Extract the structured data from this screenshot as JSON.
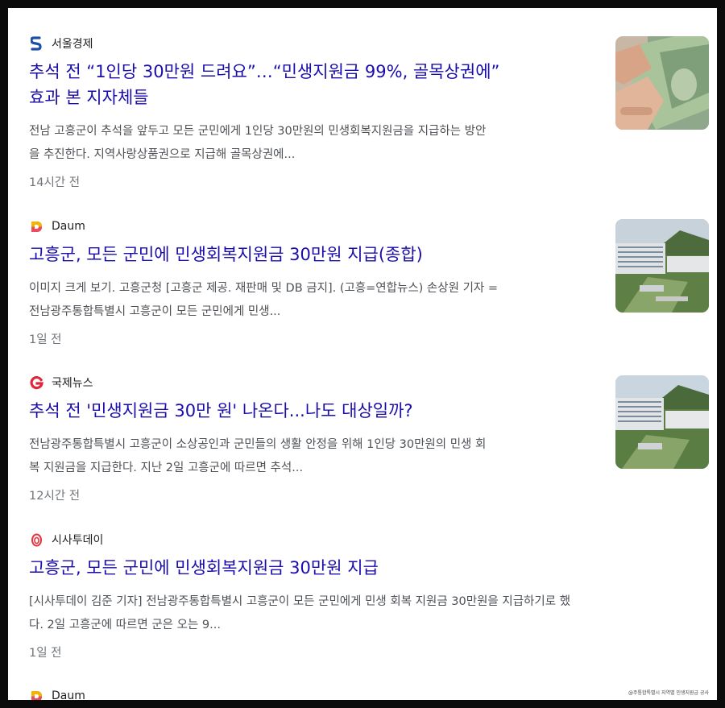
{
  "articles": [
    {
      "source": "서울경제",
      "source_icon": "seoul-economy-logo",
      "title_line1": "추석 전 “1인당 30만원 드려요”…“민생지원금 99%, 골목상권에”",
      "title_line2": "효과 본 지자체들",
      "snippet_line1": "전남 고흥군이 추석을 앞두고 모든 군민에게 1인당 30만원의 민생회복지원금을 지급하는 방안",
      "snippet_line2": "을 추진한다. 지역사랑상품권으로 지급해 골목상권에...",
      "time": "14시간 전",
      "thumb": "money-photo"
    },
    {
      "source": "Daum",
      "source_icon": "daum-logo",
      "title_line1": "고흥군, 모든 군민에 민생회복지원금 30만원 지급(종합)",
      "snippet_line1": "이미지 크게 보기. 고흥군청 [고흥군 제공. 재판매 및 DB 금지]. (고흥=연합뉴스) 손상원 기자 =",
      "snippet_line2": "전남광주통합특별시 고흥군이 모든 군민에게 민생...",
      "time": "1일 전",
      "thumb": "county-office-photo"
    },
    {
      "source": "국제뉴스",
      "source_icon": "gukje-news-logo",
      "title_line1": "추석 전 '민생지원금 30만 원' 나온다...나도 대상일까?",
      "snippet_line1": "전남광주통합특별시 고흥군이 소상공인과 군민들의 생활 안정을 위해 1인당 30만원의 민생 회",
      "snippet_line2": "복 지원금을 지급한다. 지난 2일 고흥군에 따르면 추석...",
      "time": "12시간 전",
      "thumb": "county-office-photo"
    },
    {
      "source": "시사투데이",
      "source_icon": "sisa-today-logo",
      "title_line1": "고흥군, 모든 군민에 민생회복지원금 30만원 지급",
      "snippet_line1": "[시사투데이 김준 기자] 전남광주통합특별시 고흥군이 모든 군민에게 민생 회복 지원금 30만원을 지급하기로 했",
      "snippet_line2": "다. 2일 고흥군에 따르면 군은 오는 9...",
      "time": "1일 전"
    },
    {
      "source": "Daum",
      "source_icon": "daum-logo",
      "thumb_caption": "@주통합특별시 지역별 민생지원금 공사"
    }
  ],
  "colors": {
    "title": "#1a0dab",
    "snippet": "#4d5156",
    "time": "#70757a",
    "background": "#ffffff"
  }
}
